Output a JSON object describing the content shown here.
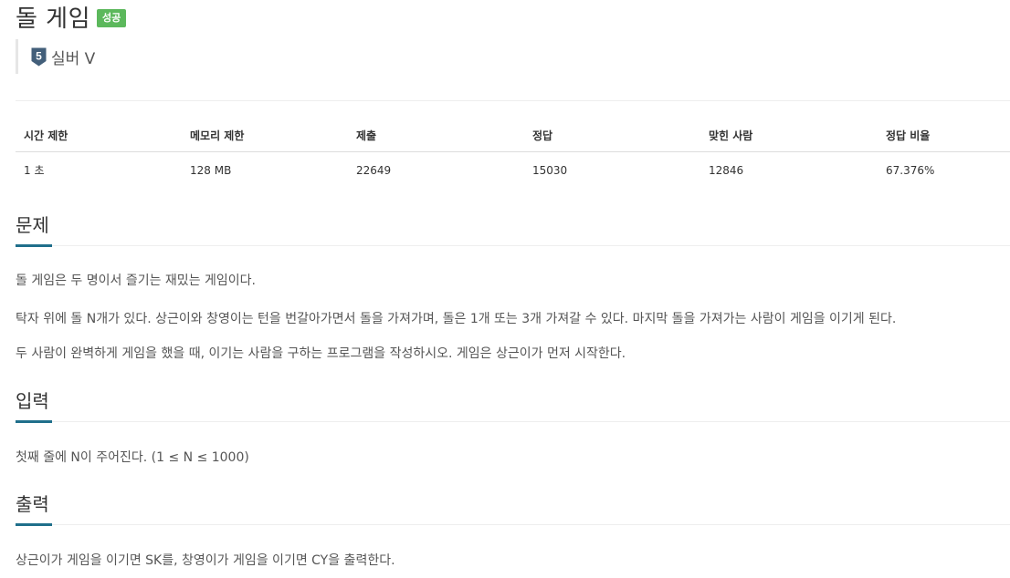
{
  "problem": {
    "title": "돌 게임",
    "badge": "성공",
    "tier": "실버 V",
    "tier_level": "5",
    "colors": {
      "badge": "#5cb85c",
      "tier": "#435f7a",
      "accent": "#0076c0"
    }
  },
  "limits": {
    "headers": [
      "시간 제한",
      "메모리 제한",
      "제출",
      "정답",
      "맞힌 사람",
      "정답 비율"
    ],
    "values": [
      "1 초",
      "128 MB",
      "22649",
      "15030",
      "12846",
      "67.376%"
    ]
  },
  "sections": {
    "problem": {
      "title": "문제",
      "paragraphs": [
        "돌 게임은 두 명이서 즐기는 재밌는 게임이다.",
        "탁자 위에 돌 N개가 있다. 상근이와 창영이는 턴을 번갈아가면서 돌을 가져가며, 돌은 1개 또는 3개 가져갈 수 있다. 마지막 돌을 가져가는 사람이 게임을 이기게 된다.",
        "두 사람이 완벽하게 게임을 했을 때, 이기는 사람을 구하는 프로그램을 작성하시오. 게임은 상근이가 먼저 시작한다."
      ]
    },
    "input": {
      "title": "입력",
      "paragraphs": [
        "첫째 줄에 N이 주어진다. (1 ≤ N ≤ 1000)"
      ]
    },
    "output": {
      "title": "출력",
      "paragraphs": [
        "상근이가 게임을 이기면 SK를, 창영이가 게임을 이기면 CY을 출력한다."
      ]
    }
  }
}
